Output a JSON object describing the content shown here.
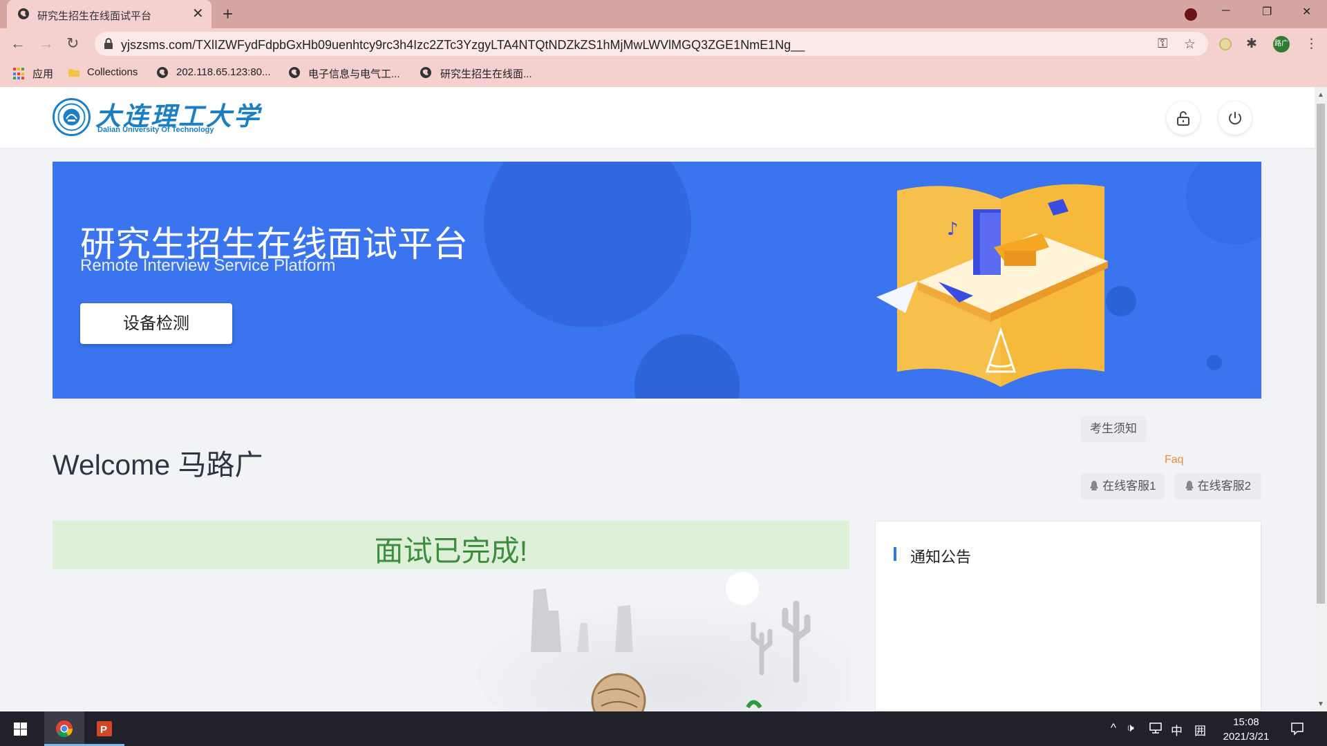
{
  "browser": {
    "tab_title": "研究生招生在线面试平台",
    "close_glyph": "✕",
    "newtab_glyph": "+",
    "url": "yjszsms.com/TXlIZWFydFdpbGxHb09uenhtcy9rc3h4Izc2ZTc3YzgyLTA4NTQtNDZkZS1hMjMwLWVlMGQ3ZGE1NmE1Ng__",
    "avatar_text": "路广",
    "window_controls": {
      "minimize": "─",
      "maximize": "❐",
      "close": "✕"
    },
    "nav": {
      "back": "←",
      "forward": "→",
      "reload": "↻"
    },
    "omnibox_icons": {
      "key": "⚿",
      "star": "☆"
    },
    "toolbar_icons": {
      "extensions": "✱",
      "menu": "⋮"
    }
  },
  "bookmarks": [
    {
      "label": "应用",
      "icon": "apps-grid-icon"
    },
    {
      "label": "Collections",
      "icon": "folder-icon"
    },
    {
      "label": "202.118.65.123:80...",
      "icon": "globe-icon"
    },
    {
      "label": "电子信息与电气工...",
      "icon": "globe-icon"
    },
    {
      "label": "研究生招生在线面...",
      "icon": "globe-icon"
    }
  ],
  "header": {
    "logo_cn": "大连理工大学",
    "logo_en": "Dalian University Of Technology"
  },
  "banner": {
    "title": "研究生招生在线面试平台",
    "subtitle": "Remote Interview Service Platform",
    "device_check_button": "设备检测"
  },
  "main": {
    "welcome": "Welcome 马路广",
    "candidate_notice": "考生须知",
    "faq": "Faq",
    "service1": "在线客服1",
    "service2": "在线客服2",
    "status_message": "面试已完成!",
    "notice_title": "通知公告"
  },
  "taskbar": {
    "time": "15:08",
    "date": "2021/3/21",
    "ime": "中",
    "ime_mode": "囲",
    "tray_up": "^",
    "volume": "🕩"
  },
  "colors": {
    "banner_blue": "#3a74ee",
    "success_bg": "#dff0d8",
    "success_text": "#3c8d3f",
    "faq_orange": "#f0883a",
    "accent_blue": "#2a7be4"
  }
}
